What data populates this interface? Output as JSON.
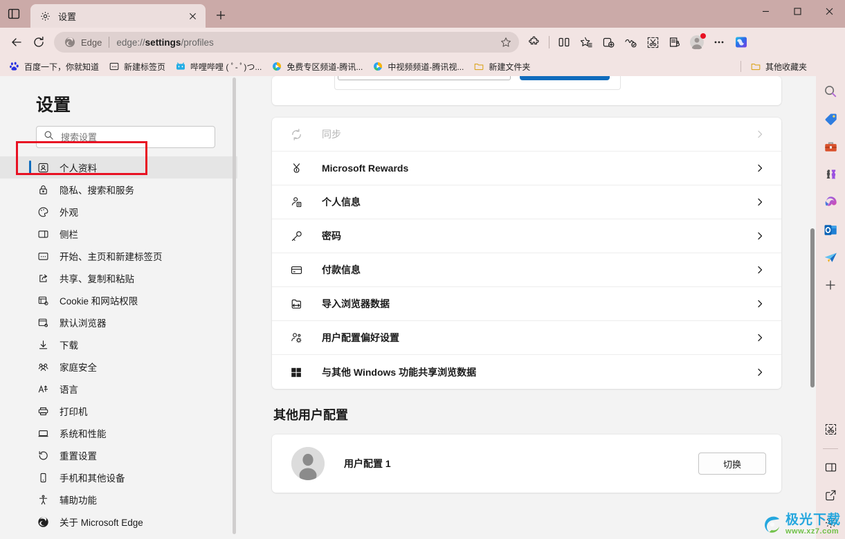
{
  "window": {
    "minimize_label": "—",
    "maximize_label": "□",
    "close_label": "✕"
  },
  "tabstrip": {
    "tab_search_icon": "tab-actions-icon",
    "tabs": [
      {
        "title": "设置",
        "favicon": "gear-icon",
        "close_label": "✕"
      }
    ],
    "new_tab_label": "+"
  },
  "toolbar": {
    "back_label": "←",
    "refresh_label": "⟳",
    "omnibox": {
      "brand": "Edge",
      "url_prefix": "edge://",
      "url_emphasis": "settings",
      "url_suffix": "/profiles",
      "full_url": "edge://settings/profiles",
      "favorite_icon": "star-icon"
    },
    "buttons": [
      {
        "name": "extensions-icon",
        "label": "扩展"
      },
      {
        "name": "split-screen-icon",
        "label": "拆分屏幕"
      },
      {
        "name": "favorites-icon",
        "label": "收藏夹"
      },
      {
        "name": "collections-icon",
        "label": "集锦"
      },
      {
        "name": "browser-essentials-icon",
        "label": "浏览器基本功能"
      },
      {
        "name": "screenshot-icon",
        "label": "屏幕截图"
      },
      {
        "name": "read-aloud-icon",
        "label": "朗读"
      },
      {
        "name": "profile-avatar-icon",
        "label": "个人资料"
      },
      {
        "name": "more-options-icon",
        "label": "设置及其他"
      },
      {
        "name": "copilot-icon",
        "label": "Copilot"
      }
    ]
  },
  "bookmarks_bar": {
    "items": [
      {
        "label": "百度一下，你就知道",
        "icon": "baidu-favicon"
      },
      {
        "label": "新建标签页",
        "icon": "newtab-favicon"
      },
      {
        "label": "哔哩哔哩 ( ﾟ- ﾟ)つ...",
        "icon": "bilibili-favicon"
      },
      {
        "label": "免费专区频道-腾讯...",
        "icon": "tencent-video-favicon"
      },
      {
        "label": "中视频频道-腾讯视...",
        "icon": "tencent-video-favicon"
      },
      {
        "label": "新建文件夹",
        "icon": "folder-icon"
      }
    ],
    "other_favorites": {
      "label": "其他收藏夹",
      "icon": "folder-icon"
    }
  },
  "settings": {
    "title": "设置",
    "search": {
      "placeholder": "搜索设置",
      "value": "",
      "icon": "search-icon"
    },
    "nav_items": [
      {
        "label": "个人资料",
        "icon": "profile-icon",
        "active": true
      },
      {
        "label": "隐私、搜索和服务",
        "icon": "lock-icon",
        "active": false
      },
      {
        "label": "外观",
        "icon": "palette-icon",
        "active": false
      },
      {
        "label": "侧栏",
        "icon": "sidebar-icon",
        "active": false
      },
      {
        "label": "开始、主页和新建标签页",
        "icon": "home-icon",
        "active": false
      },
      {
        "label": "共享、复制和粘贴",
        "icon": "share-icon",
        "active": false
      },
      {
        "label": "Cookie 和网站权限",
        "icon": "cookie-icon",
        "active": false
      },
      {
        "label": "默认浏览器",
        "icon": "default-browser-icon",
        "active": false
      },
      {
        "label": "下载",
        "icon": "download-icon",
        "active": false
      },
      {
        "label": "家庭安全",
        "icon": "family-icon",
        "active": false
      },
      {
        "label": "语言",
        "icon": "language-icon",
        "active": false
      },
      {
        "label": "打印机",
        "icon": "printer-icon",
        "active": false
      },
      {
        "label": "系统和性能",
        "icon": "system-icon",
        "active": false
      },
      {
        "label": "重置设置",
        "icon": "reset-icon",
        "active": false
      },
      {
        "label": "手机和其他设备",
        "icon": "phone-icon",
        "active": false
      },
      {
        "label": "辅助功能",
        "icon": "accessibility-icon",
        "active": false
      },
      {
        "label": "关于 Microsoft Edge",
        "icon": "edge-icon",
        "active": false
      }
    ]
  },
  "content": {
    "profile_rows": [
      {
        "label": "同步",
        "icon": "sync-icon",
        "disabled": true,
        "chevron": "›"
      },
      {
        "label": "Microsoft Rewards",
        "icon": "rewards-medal-icon",
        "disabled": false,
        "chevron": "›"
      },
      {
        "label": "个人信息",
        "icon": "personal-info-icon",
        "disabled": false,
        "chevron": "›"
      },
      {
        "label": "密码",
        "icon": "key-icon",
        "disabled": false,
        "chevron": "›"
      },
      {
        "label": "付款信息",
        "icon": "credit-card-icon",
        "disabled": false,
        "chevron": "›"
      },
      {
        "label": "导入浏览器数据",
        "icon": "import-icon",
        "disabled": false,
        "chevron": "›"
      },
      {
        "label": "用户配置偏好设置",
        "icon": "profile-preferences-icon",
        "disabled": false,
        "chevron": "›"
      },
      {
        "label": "与其他 Windows 功能共享浏览数据",
        "icon": "windows-icon",
        "disabled": false,
        "chevron": "›"
      }
    ],
    "other_profiles_title": "其他用户配置",
    "other_profiles": [
      {
        "name": "用户配置 1",
        "avatar": "person-avatar",
        "action_label": "切换"
      }
    ]
  },
  "edge_sidebar": {
    "items": [
      {
        "name": "search-icon",
        "label": "搜索"
      },
      {
        "name": "shopping-tag-icon",
        "label": "购物"
      },
      {
        "name": "tools-briefcase-icon",
        "label": "工具"
      },
      {
        "name": "games-icon",
        "label": "游戏"
      },
      {
        "name": "microsoft365-icon",
        "label": "Microsoft 365"
      },
      {
        "name": "outlook-icon",
        "label": "Outlook"
      },
      {
        "name": "paper-plane-icon",
        "label": "发送"
      },
      {
        "name": "add-sidebar-app-icon",
        "label": "+"
      }
    ],
    "bottom_items": [
      {
        "name": "screenshot-scissors-icon",
        "label": "截图"
      },
      {
        "name": "split-pane-icon",
        "label": "分屏"
      },
      {
        "name": "open-external-icon",
        "label": "在新窗口打开"
      },
      {
        "name": "sidebar-settings-gear-icon",
        "label": "侧栏设置"
      }
    ]
  },
  "watermark": {
    "title": "极光下载",
    "url": "www.xz7.com"
  },
  "colors": {
    "accent": "#0f6cbd",
    "titlebar": "#cbaaa8",
    "toolbar": "#f2e4e3",
    "annotation": "#e81123"
  }
}
